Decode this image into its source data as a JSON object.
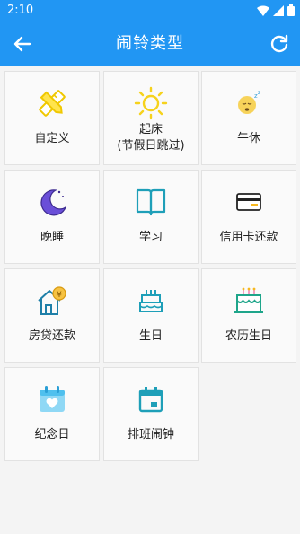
{
  "status_bar": {
    "time": "2:10"
  },
  "toolbar": {
    "title": "闹铃类型"
  },
  "types": [
    {
      "label": "自定义"
    },
    {
      "label_line1": "起床",
      "label_line2": "(节假日跳过)"
    },
    {
      "label": "午休"
    },
    {
      "label": "晚睡"
    },
    {
      "label": "学习"
    },
    {
      "label": "信用卡还款"
    },
    {
      "label": "房贷还款"
    },
    {
      "label": "生日"
    },
    {
      "label": "农历生日"
    },
    {
      "label": "纪念日"
    },
    {
      "label": "排班闹钟"
    }
  ],
  "colors": {
    "primary": "#2196f3",
    "accent_yellow": "#f6d21c",
    "accent_purple": "#6a4fd8",
    "accent_teal": "#1e9fb8"
  }
}
